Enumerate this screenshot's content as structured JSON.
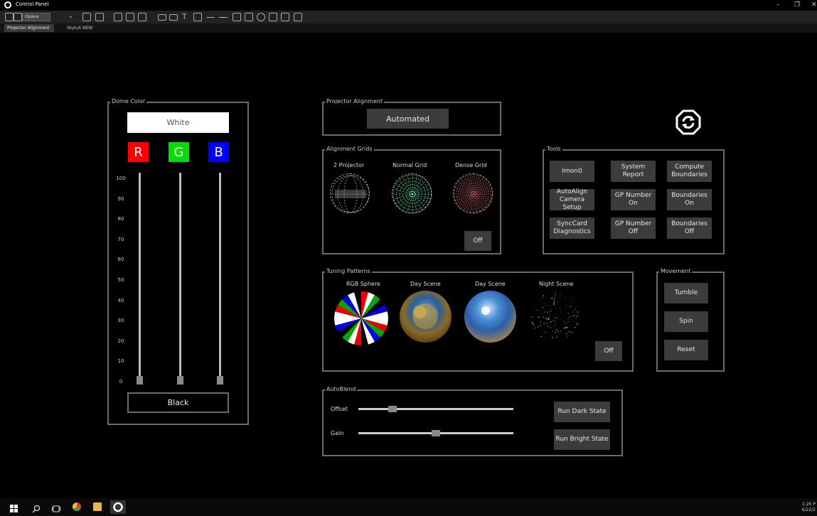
{
  "window": {
    "title": "Control Panel",
    "minimize": "–",
    "restore": "❐",
    "close": "✕"
  },
  "toolbar": {
    "select_value": "Opava"
  },
  "tabs": [
    {
      "label": "Projector Alignment"
    },
    {
      "label": "SkyluX NEW"
    }
  ],
  "dome_color": {
    "title": "Dome Color",
    "white_label": "White",
    "black_label": "Black",
    "channels": [
      {
        "label": "R",
        "color": "#ff0000",
        "value": 0
      },
      {
        "label": "G",
        "color": "#00dd00",
        "value": 0
      },
      {
        "label": "B",
        "color": "#0000ff",
        "value": 0
      }
    ],
    "ticks": [
      "100",
      "90",
      "80",
      "70",
      "60",
      "50",
      "40",
      "30",
      "20",
      "10",
      "0"
    ]
  },
  "projector_alignment": {
    "title": "Projector Alignment",
    "button": "Automated"
  },
  "alignment_grids": {
    "title": "Alignment Grids",
    "items": [
      {
        "label": "2 Projector"
      },
      {
        "label": "Normal Grid"
      },
      {
        "label": "Dense Grid"
      }
    ],
    "off_label": "Off"
  },
  "tools": {
    "title": "Tools",
    "buttons": [
      "Imon0",
      "System Report",
      "Compute Boundaries",
      "AutoAlign Camera Setup",
      "GP Number On",
      "Boundaries On",
      "SyncCard Diagnostics",
      "GP Number Off",
      "Boundaries Off"
    ]
  },
  "tuning_patterns": {
    "title": "Tuning Patterns",
    "items": [
      {
        "label": "RGB Sphere"
      },
      {
        "label": "Day Scene"
      },
      {
        "label": "Day Scene"
      },
      {
        "label": "Night Scene"
      }
    ],
    "off_label": "Off"
  },
  "movement": {
    "title": "Movement",
    "buttons": [
      "Tumble",
      "Spin",
      "Reset"
    ]
  },
  "autoblend": {
    "title": "AutoBlend",
    "offset_label": "Offset",
    "gain_label": "Gain",
    "offset_value": 0.22,
    "gain_value": 0.5,
    "run_dark": "Run Dark State",
    "run_bright": "Run Bright State"
  },
  "taskbar": {
    "time": "1:26 P",
    "date": "6/22/2"
  }
}
